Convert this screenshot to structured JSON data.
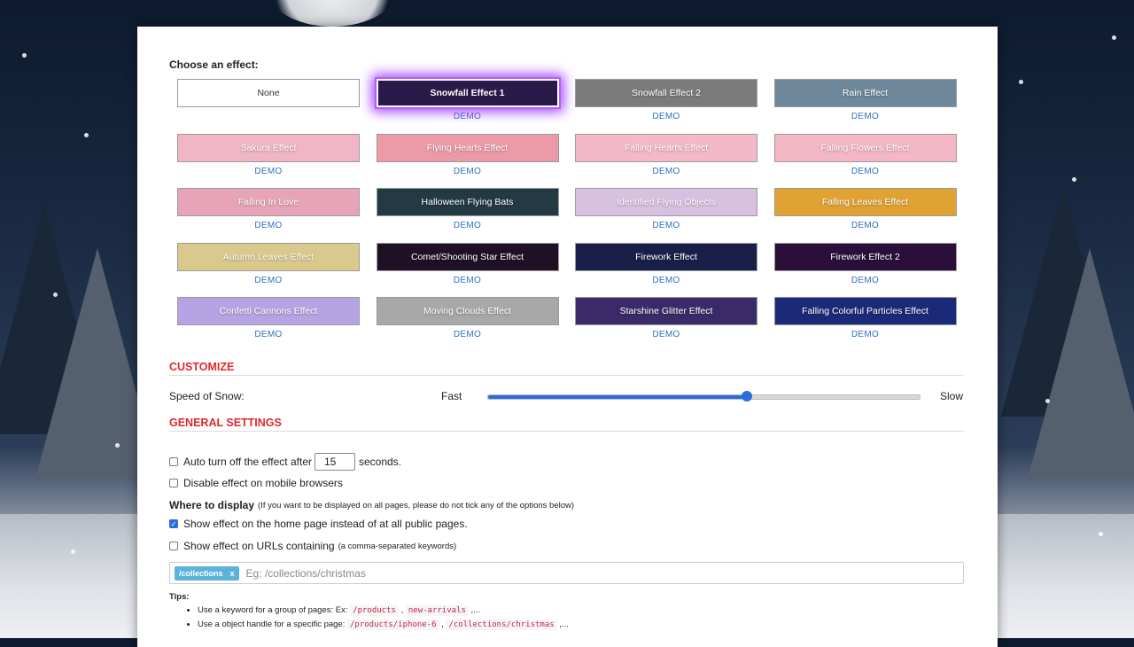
{
  "choose_label": "Choose an effect:",
  "effects": [
    {
      "label": "None",
      "demo": "",
      "bg": "#ffffff"
    },
    {
      "label": "Snowfall Effect 1",
      "demo": "DEMO",
      "bg": "#2a1a4a",
      "selected": true
    },
    {
      "label": "Snowfall Effect 2",
      "demo": "DEMO",
      "bg": "#7b7b7b"
    },
    {
      "label": "Rain Effect",
      "demo": "DEMO",
      "bg": "#6f879a"
    },
    {
      "label": "Sakura Effect",
      "demo": "DEMO",
      "bg": "#f0b6c6"
    },
    {
      "label": "Flying Hearts Effect",
      "demo": "DEMO",
      "bg": "#ec9aa8"
    },
    {
      "label": "Falling Hearts Effect",
      "demo": "DEMO",
      "bg": "#f3b9c8"
    },
    {
      "label": "Falling Flowers Effect",
      "demo": "DEMO",
      "bg": "#f4b7c5"
    },
    {
      "label": "Falling In Love",
      "demo": "DEMO",
      "bg": "#e7a3b7"
    },
    {
      "label": "Halloween Flying Bats",
      "demo": "DEMO",
      "bg": "#233a44"
    },
    {
      "label": "Identified Flying Objects",
      "demo": "DEMO",
      "bg": "#d7c0e0"
    },
    {
      "label": "Falling Leaves Effect",
      "demo": "DEMO",
      "bg": "#e0a233"
    },
    {
      "label": "Autumn Leaves Effect",
      "demo": "DEMO",
      "bg": "#d9c98c"
    },
    {
      "label": "Comet/Shooting Star Effect",
      "demo": "DEMO",
      "bg": "#1f1025"
    },
    {
      "label": "Firework Effect",
      "demo": "DEMO",
      "bg": "#1a1f4a"
    },
    {
      "label": "Firework Effect 2",
      "demo": "DEMO",
      "bg": "#2a0f3a"
    },
    {
      "label": "Confetti Cannons Effect",
      "demo": "DEMO",
      "bg": "#b6a3e3"
    },
    {
      "label": "Moving Clouds Effect",
      "demo": "DEMO",
      "bg": "#a8a8a8"
    },
    {
      "label": "Starshine Glitter Effect",
      "demo": "DEMO",
      "bg": "#3a2a6a"
    },
    {
      "label": "Falling Colorful Particles Effect",
      "demo": "DEMO",
      "bg": "#1b2a78"
    }
  ],
  "customize": {
    "title": "CUSTOMIZE",
    "speed_label": "Speed of Snow:",
    "fast": "Fast",
    "slow": "Slow",
    "speed_value": 0.6
  },
  "general": {
    "title": "GENERAL SETTINGS",
    "auto_off_pre": "Auto turn off the effect after",
    "auto_off_value": "15",
    "auto_off_post": "seconds.",
    "disable_mobile": "Disable effect on mobile browsers",
    "where_title": "Where to display",
    "where_note": "(If you want to be displayed on all pages, please do not tick any of the options below)",
    "home_only": "Show effect on the home page instead of at all public pages.",
    "urls": "Show effect on URLs containing",
    "urls_note": "(a comma-separated keywords)",
    "tag": "/collections",
    "tag_remove": "x",
    "placeholder": "Eg: /collections/christmas"
  },
  "tips": {
    "title": "Tips:",
    "items": [
      {
        "text": "Use a keyword for a group of pages: Ex: ",
        "codes": [
          "/products",
          "new-arrivals"
        ]
      },
      {
        "text": "Use a object handle for a specific page: ",
        "codes": [
          "/products/iphone-6",
          "/collections/christmas"
        ]
      }
    ]
  }
}
